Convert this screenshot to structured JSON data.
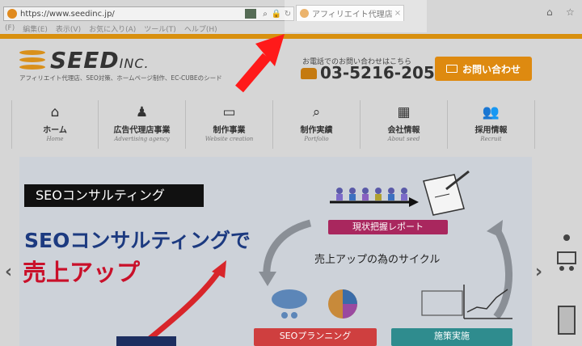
{
  "browser": {
    "url": "https://www.seedinc.jp/",
    "tab_title": "アフィリエイト代理店・S...",
    "tab_close": "×",
    "menu": [
      "(F)",
      "編集(E)",
      "表示(V)",
      "お気に入り(A)",
      "ツール(T)",
      "ヘルプ(H)"
    ],
    "search_glyph": "⌕",
    "lock_glyph": "🔒",
    "reload_glyph": "↻"
  },
  "header": {
    "brand": "SEED",
    "brand_suffix": "INC.",
    "tagline": "アフィリエイト代理店、SEO対策、ホームページ制作、EC-CUBEのシード",
    "phone_label": "お電話でのお問い合わせはこちら",
    "phone_number": "03-5216-2055",
    "contact_button": "お問い合わせ",
    "accent": "#de8a10"
  },
  "nav": [
    {
      "label": "ホーム",
      "sub": "Home",
      "icon": "home-icon",
      "glyph": "⌂"
    },
    {
      "label": "広告代理店事業",
      "sub": "Advertising agency",
      "icon": "team-icon",
      "glyph": "♟"
    },
    {
      "label": "制作事業",
      "sub": "Website creation",
      "icon": "monitor-tool-icon",
      "glyph": "▭"
    },
    {
      "label": "制作実績",
      "sub": "Portfolio",
      "icon": "search-monitor-icon",
      "glyph": "⌕"
    },
    {
      "label": "会社情報",
      "sub": "About seed",
      "icon": "building-icon",
      "glyph": "▦"
    },
    {
      "label": "採用情報",
      "sub": "Recruit",
      "icon": "people-icon",
      "glyph": "👥"
    }
  ],
  "hero": {
    "tag": "SEOコンサルティング",
    "headline": "SEOコンサルティングで",
    "headline2": "売上アップ",
    "cycle_title": "売上アップの為のサイクル",
    "report": "現状把握レポート",
    "planning": "SEOプランニング",
    "execution": "施策実施"
  },
  "slider": {
    "prev": "‹",
    "next": "›"
  }
}
